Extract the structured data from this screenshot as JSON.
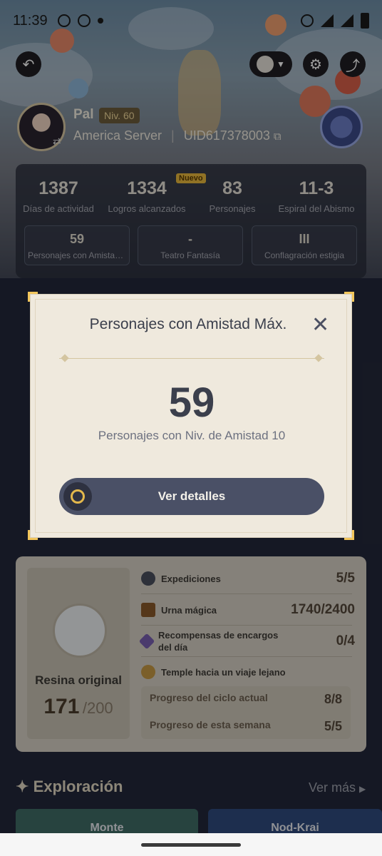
{
  "status_bar": {
    "time": "11:39"
  },
  "profile": {
    "name": "Pal",
    "level": "Niv. 60",
    "server": "America Server",
    "uid": "UID617378003"
  },
  "stats": [
    {
      "value": "1387",
      "label": "Días de actividad"
    },
    {
      "value": "1334",
      "label": "Logros alcanzados",
      "badge": "Nuevo"
    },
    {
      "value": "83",
      "label": "Personajes"
    },
    {
      "value": "11-3",
      "label": "Espiral del Abismo"
    }
  ],
  "subcards": [
    {
      "value": "59",
      "label": "Personajes con Amistad Máx."
    },
    {
      "value": "-",
      "label": "Teatro Fantasía"
    },
    {
      "value": "III",
      "label": "Conflagración estigia"
    }
  ],
  "modal": {
    "title": "Personajes con Amistad Máx.",
    "value": "59",
    "subtitle": "Personajes con Niv. de Amistad 10",
    "button": "Ver detalles"
  },
  "resin": {
    "title": "Resina original",
    "current": "171",
    "max": "/200",
    "rows": [
      {
        "label": "Expediciones",
        "value": "5/5",
        "icon": "compass-icon"
      },
      {
        "label": "Urna mágica",
        "value": "1740/2400",
        "icon": "teapot-icon"
      },
      {
        "label": "Recompensas de encargos del día",
        "value": "0/4",
        "icon": "commission-icon"
      },
      {
        "label": "Temple hacia un viaje lejano",
        "value": "",
        "icon": "medal-icon"
      }
    ],
    "progress": [
      {
        "label": "Progreso del ciclo actual",
        "value": "8/8"
      },
      {
        "label": "Progreso de esta semana",
        "value": "5/5"
      }
    ]
  },
  "exploration": {
    "title": "Exploración",
    "more": "Ver más",
    "regions": [
      "Monte",
      "Nod-Krai"
    ]
  },
  "colors": {
    "accent": "#e3b84c",
    "button": "#4a5066",
    "modal_bg": "#efe9dd"
  }
}
